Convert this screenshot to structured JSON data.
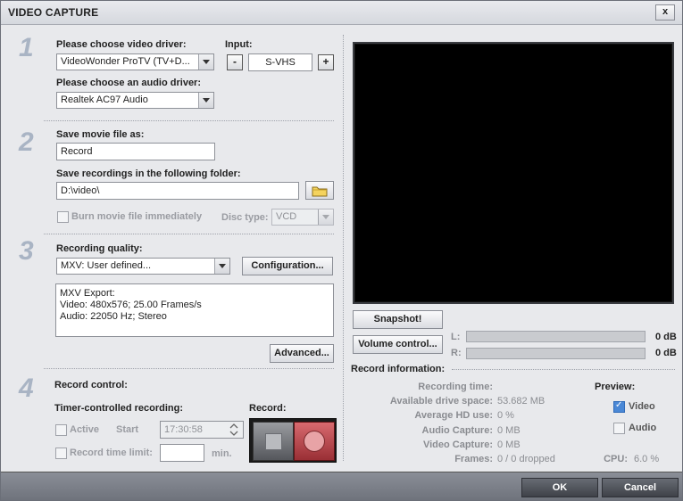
{
  "window": {
    "title": "VIDEO CAPTURE",
    "close_label": "x"
  },
  "steps": [
    "1",
    "2",
    "3",
    "4"
  ],
  "section1": {
    "video_driver_label": "Please choose video driver:",
    "video_driver_value": "VideoWonder ProTV (TV+D...",
    "input_label": "Input:",
    "input_value": "S-VHS",
    "minus": "-",
    "plus": "+",
    "audio_driver_label": "Please choose an audio driver:",
    "audio_driver_value": "Realtek AC97 Audio"
  },
  "section2": {
    "save_as_label": "Save movie file as:",
    "save_as_value": "Record",
    "folder_label": "Save recordings in the following folder:",
    "folder_value": "D:\\video\\",
    "burn_label": "Burn movie file immediately",
    "disc_type_label": "Disc type:",
    "disc_type_value": "VCD"
  },
  "section3": {
    "quality_label": "Recording quality:",
    "quality_value": "MXV: User defined...",
    "config_button": "Configuration...",
    "info_lines": [
      "MXV Export:",
      "Video: 480x576; 25.00 Frames/s",
      "Audio: 22050 Hz; Stereo"
    ],
    "advanced_button": "Advanced..."
  },
  "section4": {
    "record_control_label": "Record control:",
    "timer_label": "Timer-controlled recording:",
    "active_label": "Active",
    "start_label": "Start",
    "start_value": "17:30:58",
    "limit_label": "Record time limit:",
    "limit_value": "",
    "min_label": "min.",
    "record_label": "Record:"
  },
  "preview_panel": {
    "snapshot_button": "Snapshot!",
    "volume_button": "Volume control...",
    "left_channel": "L:",
    "right_channel": "R:",
    "left_db": "0 dB",
    "right_db": "0 dB"
  },
  "record_info": {
    "title": "Record information:",
    "rows": [
      {
        "label": "Recording time:",
        "value": ""
      },
      {
        "label": "Available drive space:",
        "value": "53.682 MB"
      },
      {
        "label": "Average HD use:",
        "value": "0 %"
      },
      {
        "label": "Audio Capture:",
        "value": "0 MB"
      },
      {
        "label": "Video Capture:",
        "value": "0 MB"
      },
      {
        "label": "Frames:",
        "value": "0 / 0 dropped"
      }
    ],
    "preview_label": "Preview:",
    "video_label": "Video",
    "audio_label": "Audio",
    "cpu_label": "CPU:",
    "cpu_value": "6.0 %"
  },
  "footer": {
    "ok_button": "OK",
    "cancel_button": "Cancel"
  },
  "icons": {
    "folder": "folder-icon",
    "stop": "stop-icon",
    "record": "record-icon"
  }
}
